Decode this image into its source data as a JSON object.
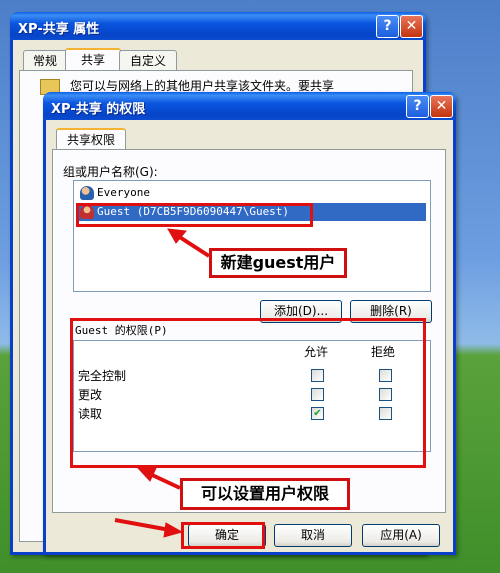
{
  "back_window": {
    "title": "XP-共享 属性",
    "tabs": [
      "常规",
      "共享",
      "自定义"
    ],
    "partial_text": "您可以与网络上的其他用户共享该文件夹。要共享"
  },
  "dialog": {
    "title": "XP-共享 的权限",
    "tab": "共享权限",
    "group_label": "组或用户名称(G):",
    "users": [
      "Everyone",
      "Guest (D7CB5F9D6090447\\Guest)"
    ],
    "selected_user_index": 1,
    "add_button": "添加(D)...",
    "remove_button": "删除(R)",
    "perm_title": "Guest 的权限(P)",
    "col_allow": "允许",
    "col_deny": "拒绝",
    "permissions": [
      {
        "name": "完全控制",
        "allow": false,
        "deny": false
      },
      {
        "name": "更改",
        "allow": false,
        "deny": false
      },
      {
        "name": "读取",
        "allow": true,
        "deny": false
      }
    ],
    "ok_button": "确定",
    "cancel_button": "取消",
    "apply_button": "应用(A)"
  },
  "titlebar_buttons": {
    "help": "?",
    "close": "✕"
  },
  "annotations": {
    "callout_guest": "新建guest用户",
    "callout_perm": "可以设置用户权限"
  },
  "colors": {
    "annotation_red": "#e01010",
    "selection_blue": "#316ac5",
    "title_blue": "#0a56e0"
  }
}
